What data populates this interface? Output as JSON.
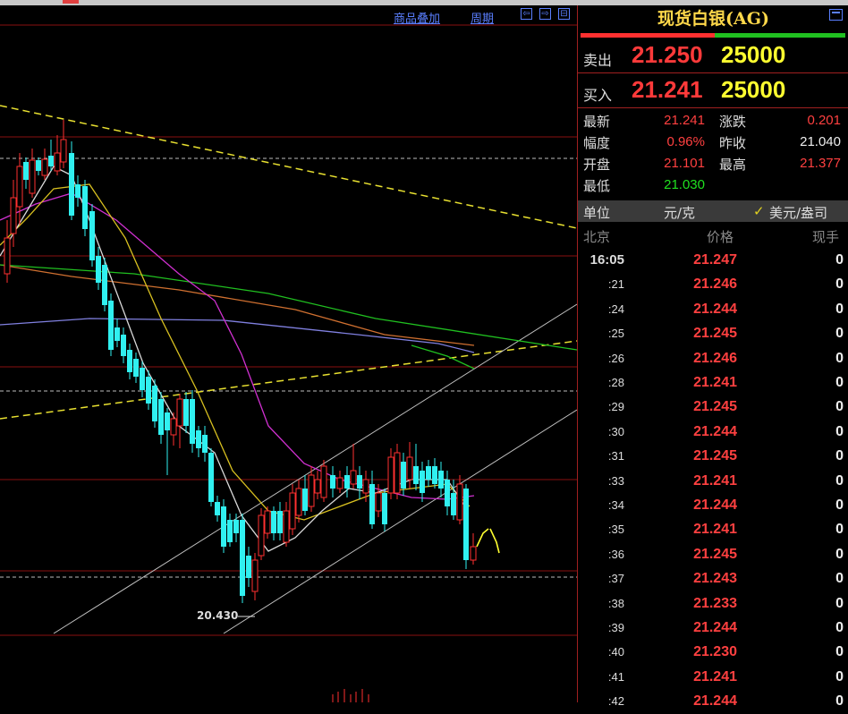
{
  "toolbar": {
    "overlay_label": "商品叠加",
    "period_label": "周期",
    "nav_prev": "⇦",
    "nav_next": "⇨",
    "nav_split": "⊟"
  },
  "chart": {
    "low_label": "20.430",
    "colors": {
      "up": "#ff3030",
      "down": "#30f0f0",
      "grid": "#8a1010",
      "trend": "#e8e030",
      "channel": "#c0c0c0",
      "ma_white": "#d8d8d8",
      "ma_yellow": "#d8c020",
      "ma_purple": "#d030d0",
      "ma_green": "#20c020",
      "ma_orange": "#d07030",
      "ma_blue": "#8080e0"
    }
  },
  "panel": {
    "title": "现货白银(AG)",
    "sell": {
      "label": "卖出",
      "price": "21.250",
      "volume": "25000"
    },
    "buy": {
      "label": "买入",
      "price": "21.241",
      "volume": "25000"
    },
    "stats": {
      "latest_label": "最新",
      "latest": "21.241",
      "change_label": "涨跌",
      "change": "0.201",
      "amplitude_label": "幅度",
      "amplitude": "0.96%",
      "prev_close_label": "昨收",
      "prev_close": "21.040",
      "open_label": "开盘",
      "open": "21.101",
      "high_label": "最高",
      "high": "21.377",
      "low_label": "最低",
      "low": "21.030"
    },
    "unit": {
      "label": "单位",
      "cny": "元/克",
      "check": "✓",
      "usd": "美元/盎司"
    },
    "ticks_header": {
      "time": "北京",
      "price": "价格",
      "qty": "现手"
    },
    "ticks": [
      {
        "time": "16:05",
        "price": "21.247",
        "qty": "0"
      },
      {
        "time": ":21",
        "price": "21.246",
        "qty": "0"
      },
      {
        "time": ":24",
        "price": "21.244",
        "qty": "0"
      },
      {
        "time": ":25",
        "price": "21.245",
        "qty": "0"
      },
      {
        "time": ":26",
        "price": "21.246",
        "qty": "0"
      },
      {
        "time": ":28",
        "price": "21.241",
        "qty": "0"
      },
      {
        "time": ":29",
        "price": "21.245",
        "qty": "0"
      },
      {
        "time": ":30",
        "price": "21.244",
        "qty": "0"
      },
      {
        "time": ":31",
        "price": "21.245",
        "qty": "0"
      },
      {
        "time": ":33",
        "price": "21.241",
        "qty": "0"
      },
      {
        "time": ":34",
        "price": "21.244",
        "qty": "0"
      },
      {
        "time": ":35",
        "price": "21.241",
        "qty": "0"
      },
      {
        "time": ":36",
        "price": "21.245",
        "qty": "0"
      },
      {
        "time": ":37",
        "price": "21.243",
        "qty": "0"
      },
      {
        "time": ":38",
        "price": "21.233",
        "qty": "0"
      },
      {
        "time": ":39",
        "price": "21.244",
        "qty": "0"
      },
      {
        "time": ":40",
        "price": "21.230",
        "qty": "0"
      },
      {
        "time": ":41",
        "price": "21.241",
        "qty": "0"
      },
      {
        "time": ":42",
        "price": "21.244",
        "qty": "0"
      }
    ]
  }
}
